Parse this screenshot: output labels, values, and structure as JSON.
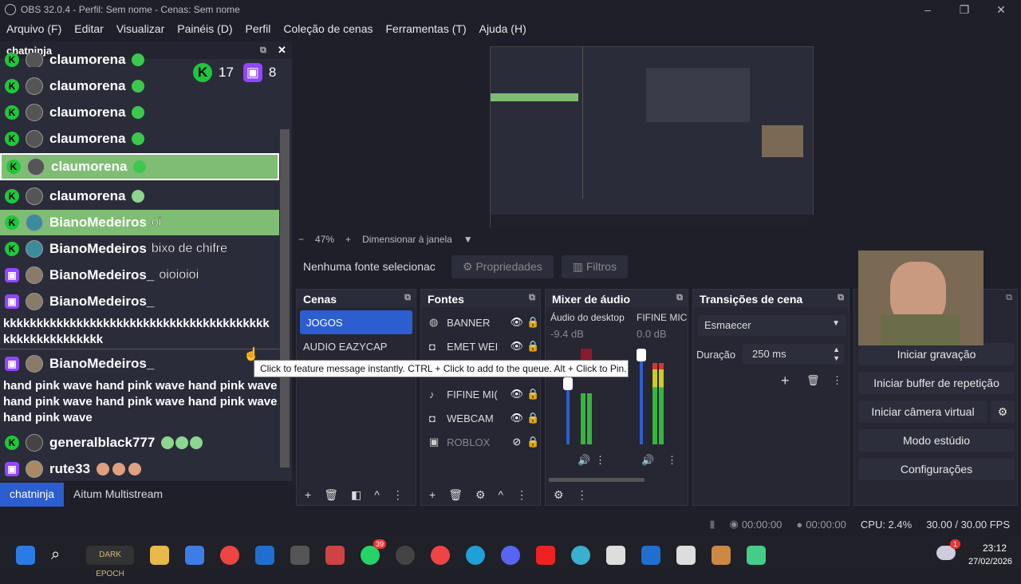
{
  "window": {
    "title": "OBS 32.0.4 - Perfil: Sem nome - Cenas: Sem nome"
  },
  "menu": [
    "Arquivo (F)",
    "Editar",
    "Visualizar",
    "Painéis (D)",
    "Perfil",
    "Coleção de cenas",
    "Ferramentas (T)",
    "Ajuda (H)"
  ],
  "chat": {
    "dock_title": "chatninja",
    "kick_viewers": "17",
    "twitch_viewers": "8",
    "rows": [
      {
        "user": "claumorena",
        "msg": ""
      },
      {
        "user": "claumorena",
        "msg": ""
      },
      {
        "user": "claumorena",
        "msg": ""
      },
      {
        "user": "claumorena",
        "msg": ""
      },
      {
        "user": "claumorena",
        "msg": ""
      },
      {
        "user": "claumorena",
        "msg": ""
      },
      {
        "user": "BianoMedeiros",
        "msg": "oi"
      },
      {
        "user": "BianoMedeiros",
        "msg": "bixo de chifre"
      },
      {
        "user": "BianoMedeiros_",
        "msg": "oioioioi"
      },
      {
        "user": "BianoMedeiros_",
        "msg": ""
      },
      {
        "user": "BianoMedeiros_",
        "msg": ""
      },
      {
        "user": "generalblack777",
        "msg": ""
      },
      {
        "user": "rute33",
        "msg": ""
      }
    ],
    "long_msg_1": "kkkkkkkkkkkkkkkkkkkkkkkkkkkkkkkkkkkkkkkk kkkkkkkkkkkkkkk",
    "long_msg_2": "hand pink wave hand pink wave hand pink wave hand pink wave hand pink wave hand pink wave hand pink wave",
    "tabs": [
      "chatninja",
      "Aitum Multistream"
    ]
  },
  "preview": {
    "zoom": "47%",
    "fit_label": "Dimensionar à janela"
  },
  "source_bar": {
    "none_selected": "Nenhuma fonte selecionac",
    "props": "Propriedades",
    "filters": "Filtros"
  },
  "scenes": {
    "title": "Cenas",
    "items": [
      "JOGOS",
      "AUDIO EAZYCAP"
    ]
  },
  "sources": {
    "title": "Fontes",
    "items": [
      "BANNER",
      "EMET WEI",
      "FIFINE MI(",
      "WEBCAM",
      "ROBLOX"
    ]
  },
  "mixer": {
    "title": "Mixer de áudio",
    "ch1": {
      "name": "Áudio do desktop",
      "db": "-9.4 dB"
    },
    "ch2": {
      "name": "FIFINE MIC",
      "db": "0.0 dB"
    },
    "scale": [
      "0",
      "-5",
      "-10",
      "-15",
      "-20",
      "-25",
      "-30",
      "-35",
      "-40",
      "-45",
      "-50",
      "-55",
      "-60"
    ]
  },
  "transitions": {
    "title": "Transições de cena",
    "type": "Esmaecer",
    "duration_label": "Duração",
    "duration": "250 ms"
  },
  "controls": {
    "rec": "Iniciar gravação",
    "buffer": "Iniciar buffer de repetição",
    "vcam": "Iniciar câmera virtual",
    "studio": "Modo estúdio",
    "settings": "Configurações"
  },
  "tooltip": "Click to feature message instantly. CTRL + Click to add to the queue. Alt + Click to Pin.",
  "status": {
    "rec_time": "00:00:00",
    "stream_time": "00:00:00",
    "cpu": "CPU: 2.4%",
    "fps": "30.00 / 30.00 FPS"
  },
  "taskbar": {
    "time": "23:12",
    "date": "27/02/2026",
    "badge_whatsapp": "39",
    "badge_weather": "1",
    "game_label": "DARK EPOCH"
  }
}
